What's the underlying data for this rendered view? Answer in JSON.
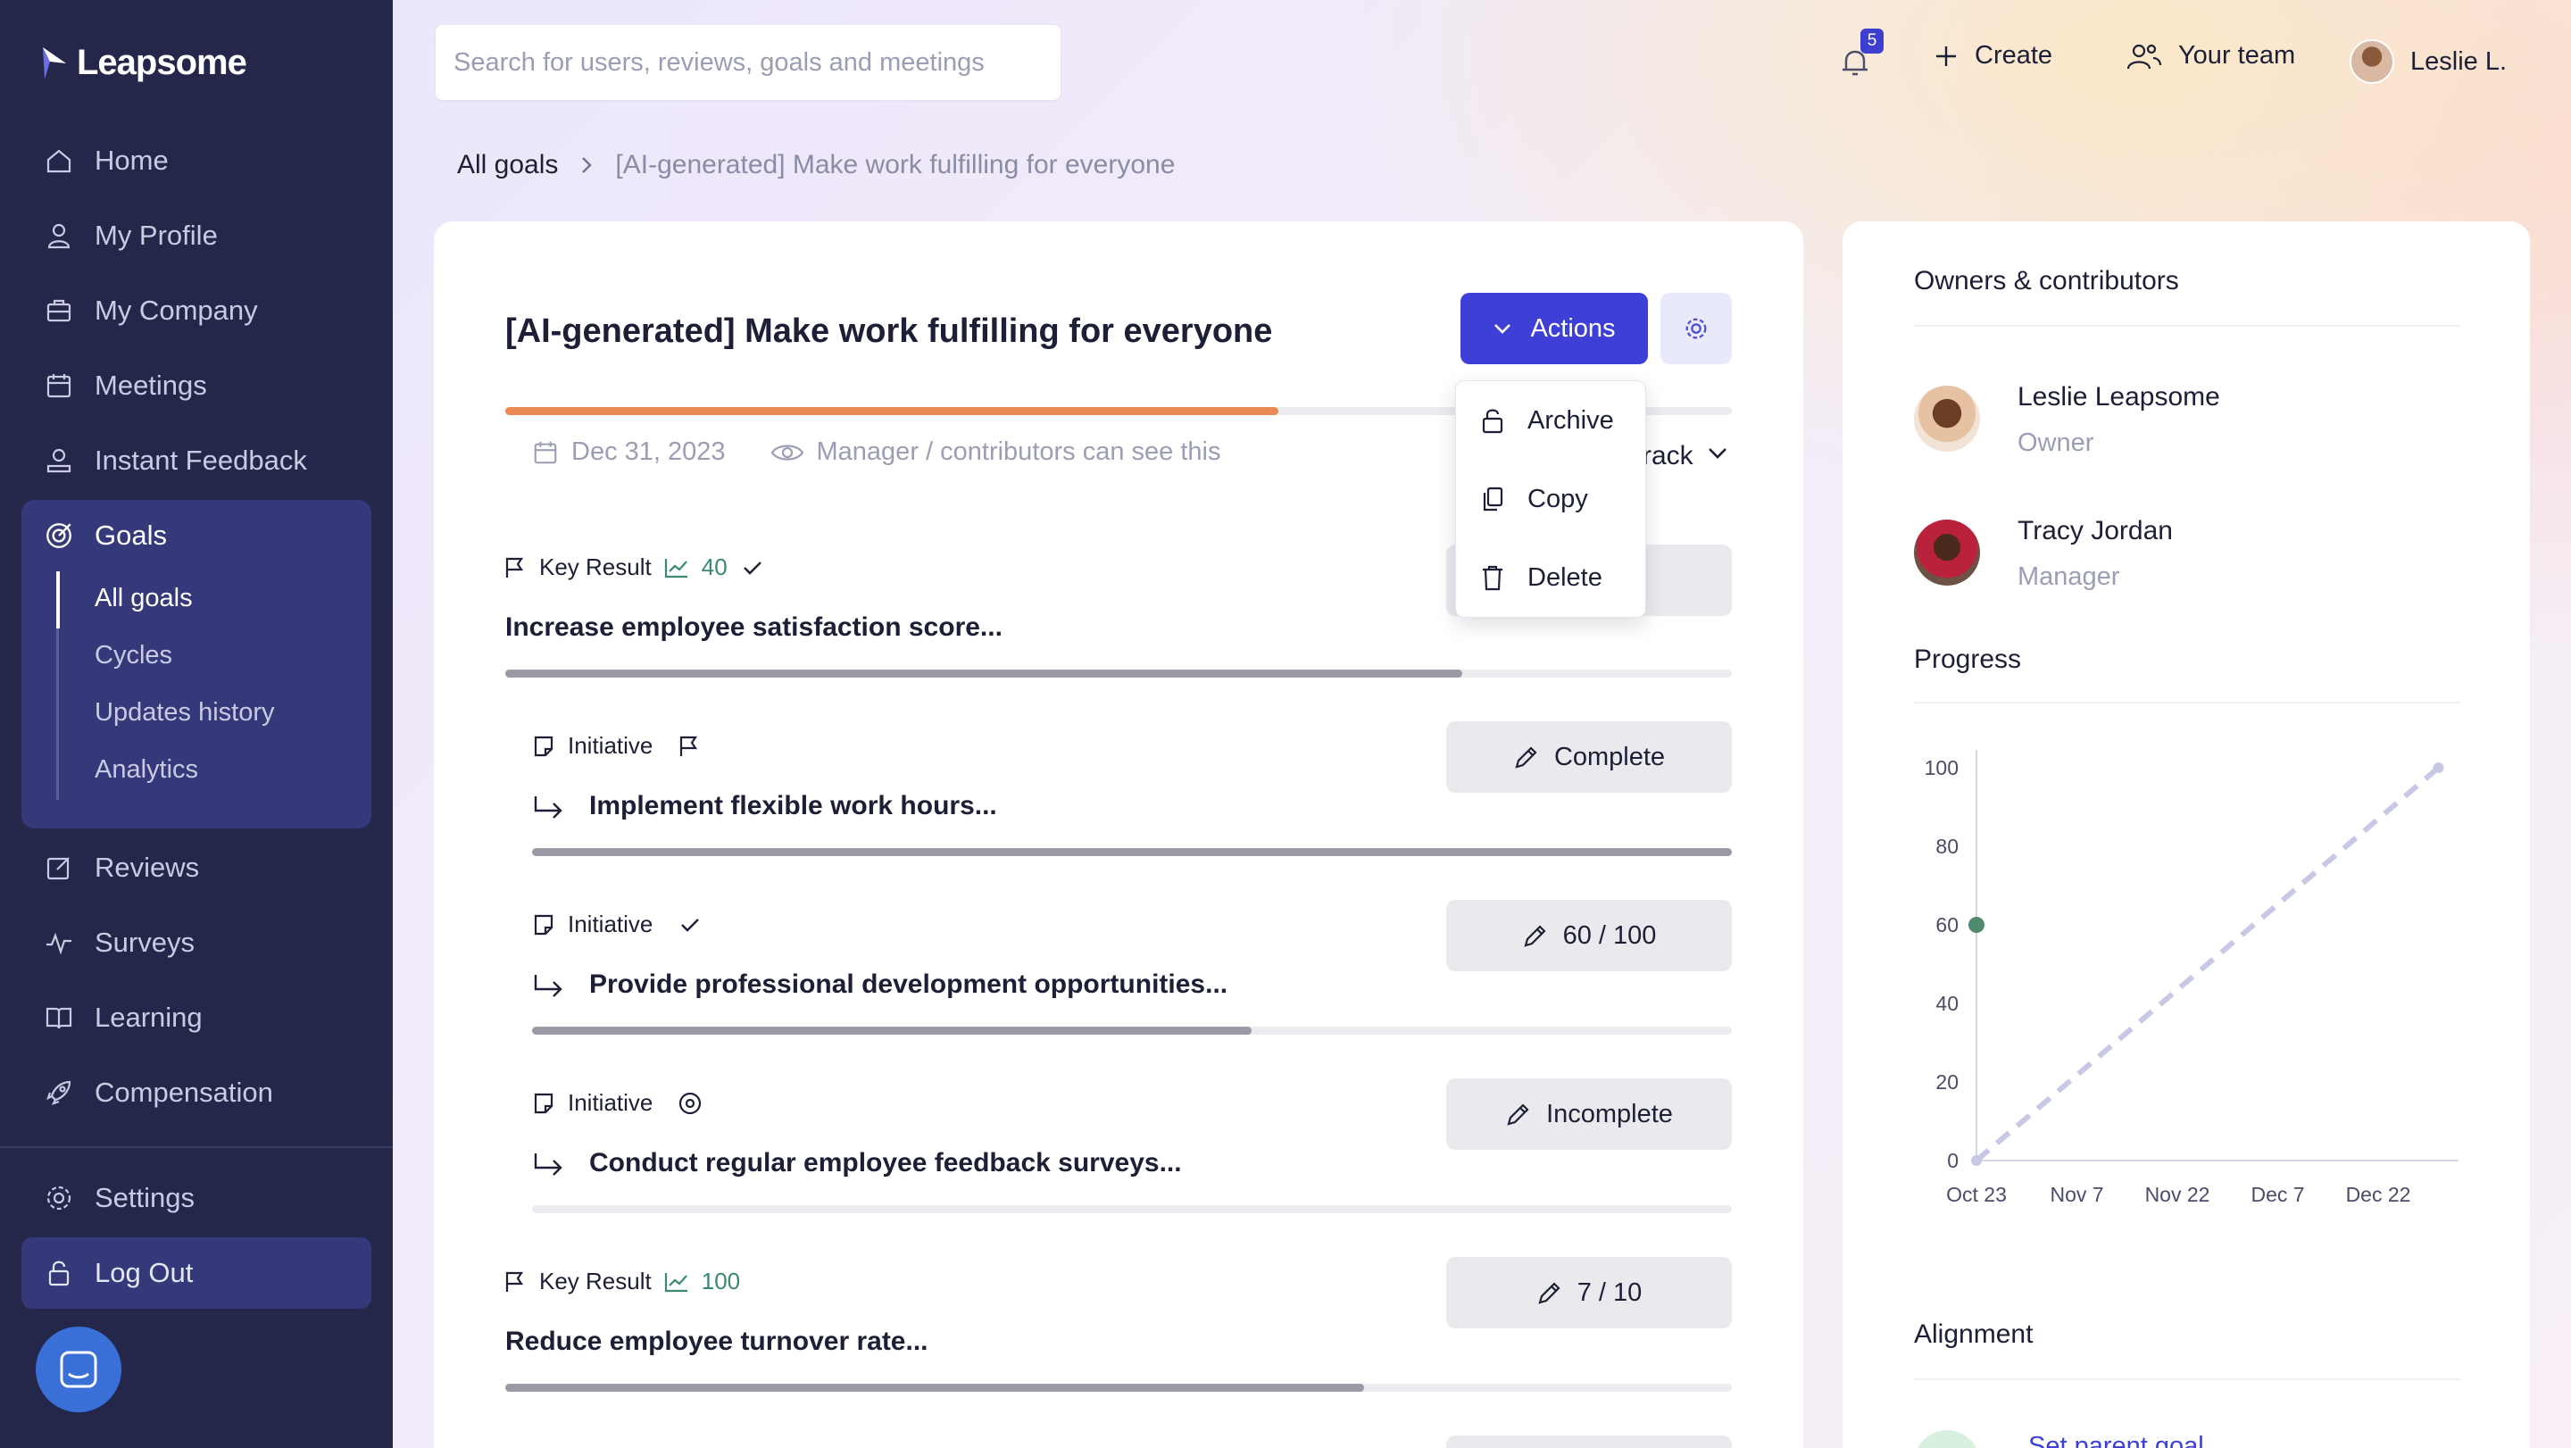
{
  "app": {
    "name": "Leapsome"
  },
  "sidebar": {
    "items": [
      {
        "label": "Home",
        "icon": "home-icon"
      },
      {
        "label": "My Profile",
        "icon": "user-icon"
      },
      {
        "label": "My Company",
        "icon": "briefcase-icon"
      },
      {
        "label": "Meetings",
        "icon": "calendar-icon"
      },
      {
        "label": "Instant Feedback",
        "icon": "feedback-icon"
      },
      {
        "label": "Goals",
        "icon": "target-icon"
      },
      {
        "label": "Reviews",
        "icon": "edit-icon"
      },
      {
        "label": "Surveys",
        "icon": "pulse-icon"
      },
      {
        "label": "Learning",
        "icon": "book-icon"
      },
      {
        "label": "Compensation",
        "icon": "rocket-icon"
      }
    ],
    "goals_sub": [
      "All goals",
      "Cycles",
      "Updates history",
      "Analytics"
    ],
    "settings": "Settings",
    "logout": "Log Out"
  },
  "topbar": {
    "search_placeholder": "Search for users, reviews, goals and meetings",
    "notifications_count": "5",
    "create": "Create",
    "team": "Your team",
    "user": "Leslie L."
  },
  "breadcrumb": {
    "root": "All goals",
    "current": "[AI-generated] Make work fulfilling for everyone"
  },
  "goal": {
    "title": "[AI-generated] Make work fulfilling for everyone",
    "actions_label": "Actions",
    "progress": 0.63,
    "due_date": "Dec 31, 2023",
    "visibility": "Manager / contributors can see this",
    "status_partial": "rack",
    "accent": "#3d3fd6",
    "progress_color": "#e98a55"
  },
  "actions_menu": [
    {
      "label": "Archive",
      "icon": "lock-icon"
    },
    {
      "label": "Copy",
      "icon": "copy-icon"
    },
    {
      "label": "Delete",
      "icon": "trash-icon"
    }
  ],
  "items": [
    {
      "type": "Key Result",
      "value": "40",
      "title": "Increase employee satisfaction score...",
      "progress": 0.78,
      "action": ""
    },
    {
      "type": "Initiative",
      "title": "Implement flexible work hours...",
      "progress": 1.0,
      "action": "Complete"
    },
    {
      "type": "Initiative",
      "title": "Provide professional development opportunities...",
      "progress": 0.6,
      "action": "60 / 100"
    },
    {
      "type": "Initiative",
      "title": "Conduct regular employee feedback surveys...",
      "progress": 0.0,
      "action": "Incomplete"
    },
    {
      "type": "Key Result",
      "value": "100",
      "title": "Reduce employee turnover rate...",
      "progress": 0.7,
      "action": "7 / 10"
    }
  ],
  "side": {
    "owners_heading": "Owners & contributors",
    "people": [
      {
        "name": "Leslie Leapsome",
        "role": "Owner"
      },
      {
        "name": "Tracy Jordan",
        "role": "Manager"
      }
    ],
    "progress_heading": "Progress",
    "alignment_heading": "Alignment",
    "set_parent": "Set parent goal"
  },
  "chart_data": {
    "type": "line",
    "x": [
      "Oct 23",
      "Nov 7",
      "Nov 22",
      "Dec 7",
      "Dec 22"
    ],
    "ylim": [
      0,
      100
    ],
    "yticks": [
      0,
      20,
      40,
      60,
      80,
      100
    ],
    "series": [
      {
        "values": [
          {
            "x": "Oct 23",
            "y": 60
          }
        ],
        "style": "point",
        "color": "#4f8a6f"
      },
      {
        "values": [
          {
            "x": "Oct 23",
            "y": 0
          },
          {
            "x": "Dec 31",
            "y": 100
          }
        ],
        "style": "dashed",
        "color": "#c7c8e6"
      }
    ]
  }
}
